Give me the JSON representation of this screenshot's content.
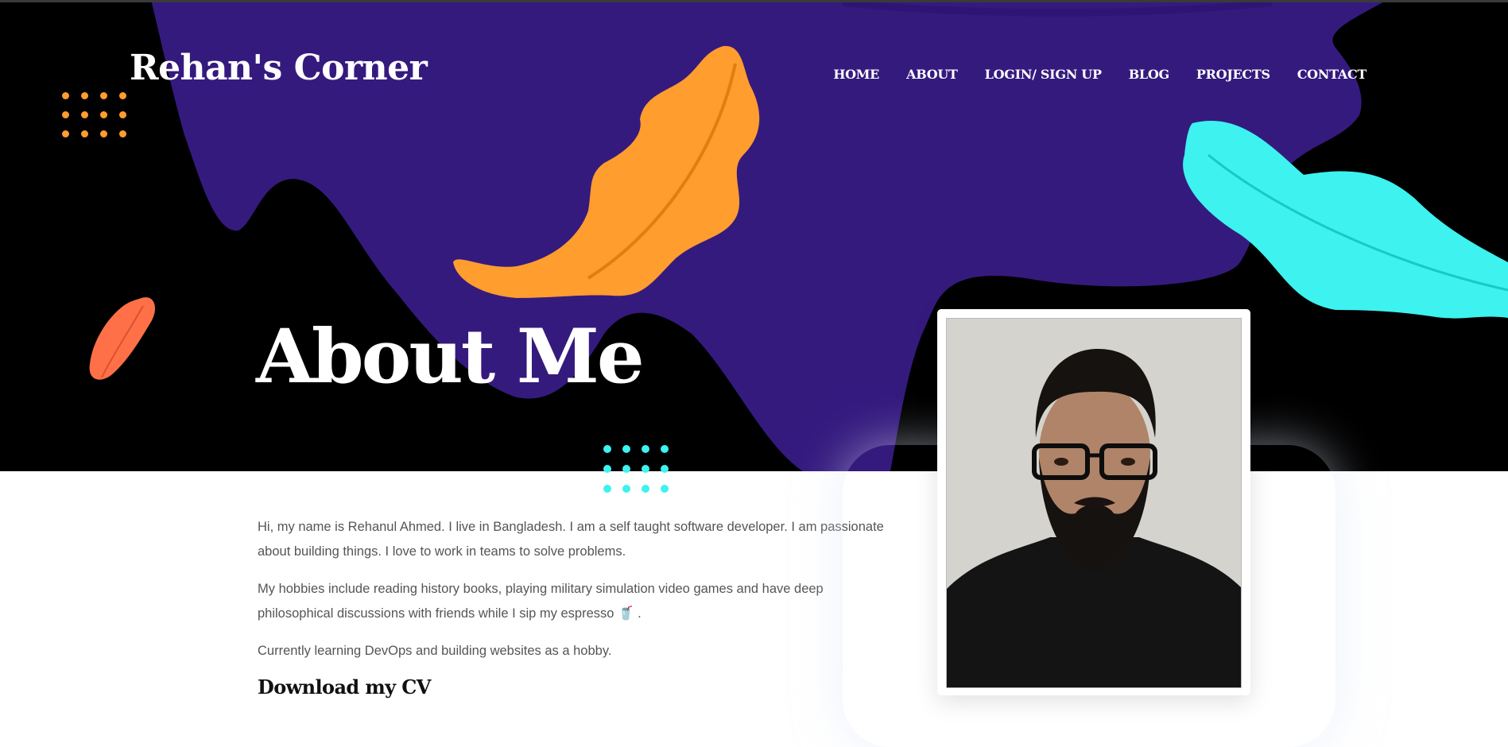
{
  "header": {
    "brand": "Rehan's Corner",
    "nav": [
      "HOME",
      "ABOUT",
      "LOGIN/ SIGN UP",
      "BLOG",
      "PROJECTS",
      "CONTACT"
    ]
  },
  "hero": {
    "title": "About Me"
  },
  "about": {
    "paragraphs": [
      "Hi, my name is Rehanul Ahmed. I live in Bangladesh. I am a self taught software developer. I am passionate about building things. I love to work in teams to solve problems.",
      "My hobbies include reading history books, playing military simulation video games and have deep philosophical discussions with friends while I sip my espresso 🥤 .",
      "Currently learning DevOps and building websites as a hobby."
    ],
    "cv_heading": "Download my CV"
  },
  "colors": {
    "hero_bg": "#000000",
    "blob": "#351a7e",
    "orange_leaf": "#ff9d2e",
    "cyan_leaf": "#3df2ef",
    "red_leaf": "#ff7048"
  },
  "icons": [
    "orange-leaf-icon",
    "cyan-leaf-icon",
    "red-leaf-icon",
    "dot-grid-icon",
    "portrait-photo"
  ]
}
